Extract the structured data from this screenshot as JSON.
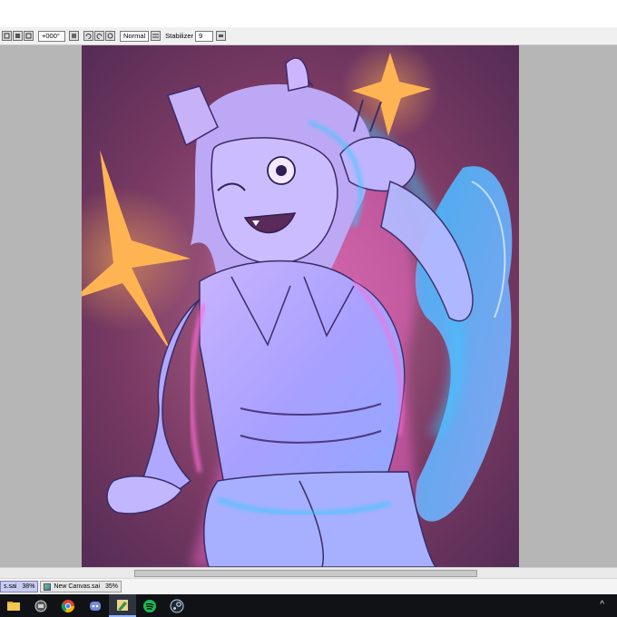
{
  "toolbar": {
    "rotation_value": "+000°",
    "blend_mode": "Normal",
    "stabilizer_label": "Stabilizer",
    "stabilizer_value": "9"
  },
  "tabs": [
    {
      "label": "s.sai",
      "zoom": "38%",
      "active": true
    },
    {
      "label": "New Canvas.sai",
      "zoom": "35%",
      "active": false
    }
  ],
  "taskbar": {
    "items": [
      "file-explorer-icon",
      "app-icon",
      "chrome-icon",
      "discord-icon",
      "paint-tool-sai-icon",
      "spotify-icon",
      "steam-icon"
    ],
    "tray": "^"
  },
  "canvas": {
    "background": "#6b2f55",
    "glow_pink": "#ff6ad5",
    "glow_cyan": "#38c8ff",
    "sparkle": "#ffb454"
  }
}
